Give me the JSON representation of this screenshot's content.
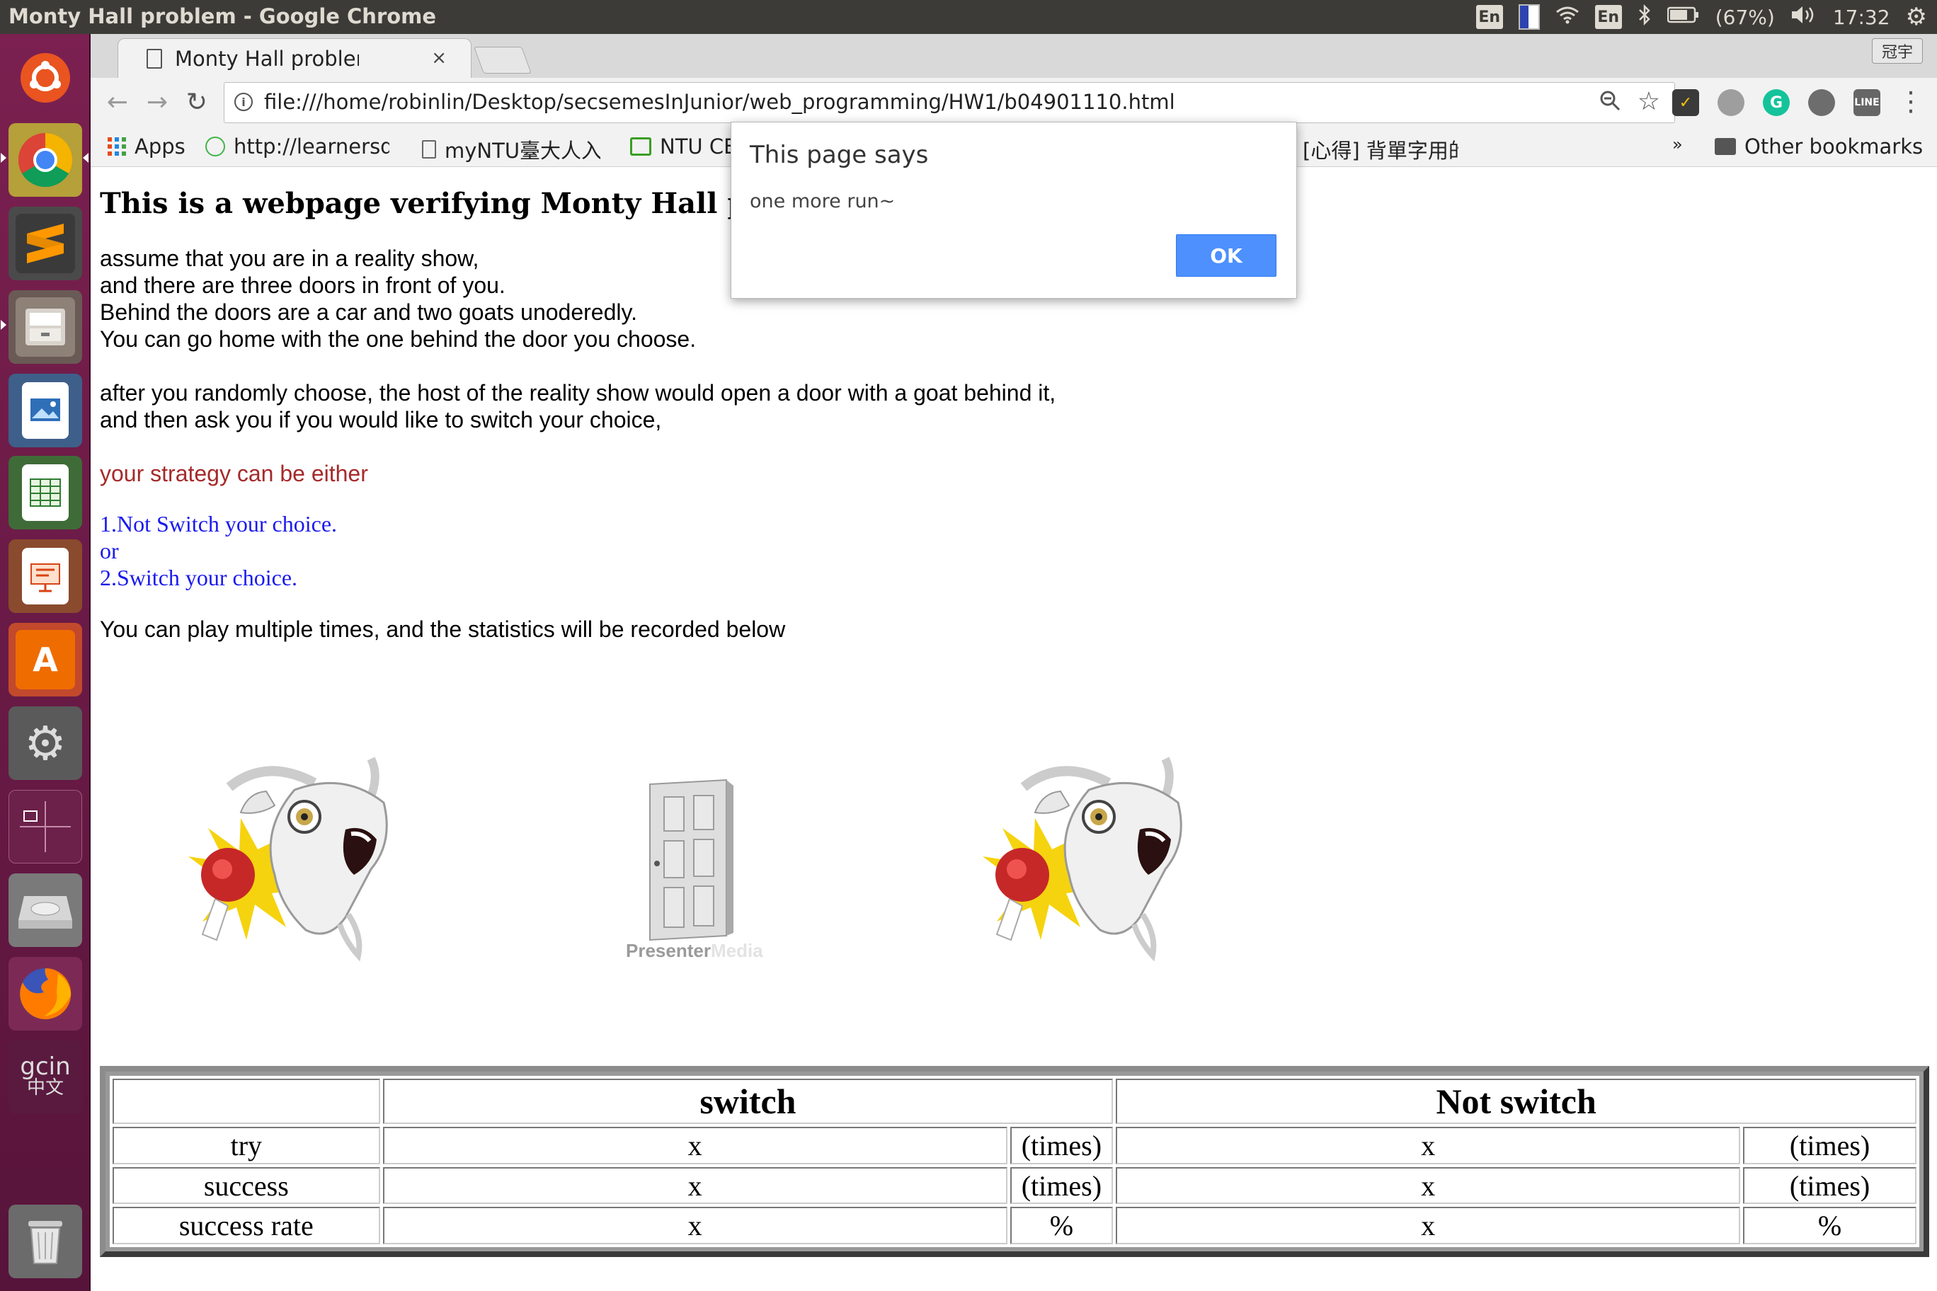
{
  "panel": {
    "window_title": "Monty Hall problem - Google Chrome",
    "kbd_left": "En",
    "kbd_right": "En",
    "battery": "(67%)",
    "clock": "17:32"
  },
  "browser": {
    "tab_title": "Monty Hall problem",
    "tab_close": "×",
    "profile": "冠宇",
    "url": "file:///home/robinlin/Desktop/secsemesInJunior/web_programming/HW1/b04901110.html",
    "bookmarks": {
      "apps": "Apps",
      "learners": "http://learnersdi",
      "myntu": "myNTU臺大人入",
      "ntu": "NTU CE",
      "xinde": "[心得] 背單字用的",
      "more": "»",
      "other": "Other bookmarks"
    }
  },
  "page": {
    "heading": "This is a webpage verifying Monty Hall problem,",
    "intro": [
      "assume that you are in a reality show,",
      "and there are three doors in front of you.",
      "Behind the doors are a car and two goats unoderedly.",
      "You can go home with the one behind the door you choose."
    ],
    "explain": [
      "after you randomly choose, the host of the reality show would open a door with a goat behind it,",
      "and then ask you if you would like to switch your choice,"
    ],
    "strategy": "your strategy can be either",
    "option1": "1.Not Switch your choice.",
    "or": "or",
    "option2": "2.Switch your choice.",
    "play": "You can play multiple times, and the statistics will be recorded below",
    "door_watermark_a": "Presenter",
    "door_watermark_b": "Media"
  },
  "table": {
    "switch": "switch",
    "not_switch": "Not switch",
    "rows": [
      {
        "label": "try",
        "sw_val": "x",
        "sw_unit": "(times)",
        "ns_val": "x",
        "ns_unit": "(times)"
      },
      {
        "label": "success",
        "sw_val": "x",
        "sw_unit": "(times)",
        "ns_val": "x",
        "ns_unit": "(times)"
      },
      {
        "label": "success rate",
        "sw_val": "x",
        "sw_unit": "%",
        "ns_val": "x",
        "ns_unit": "%"
      }
    ]
  },
  "dialog": {
    "title": "This page says",
    "message": "one more run~",
    "ok": "OK"
  }
}
